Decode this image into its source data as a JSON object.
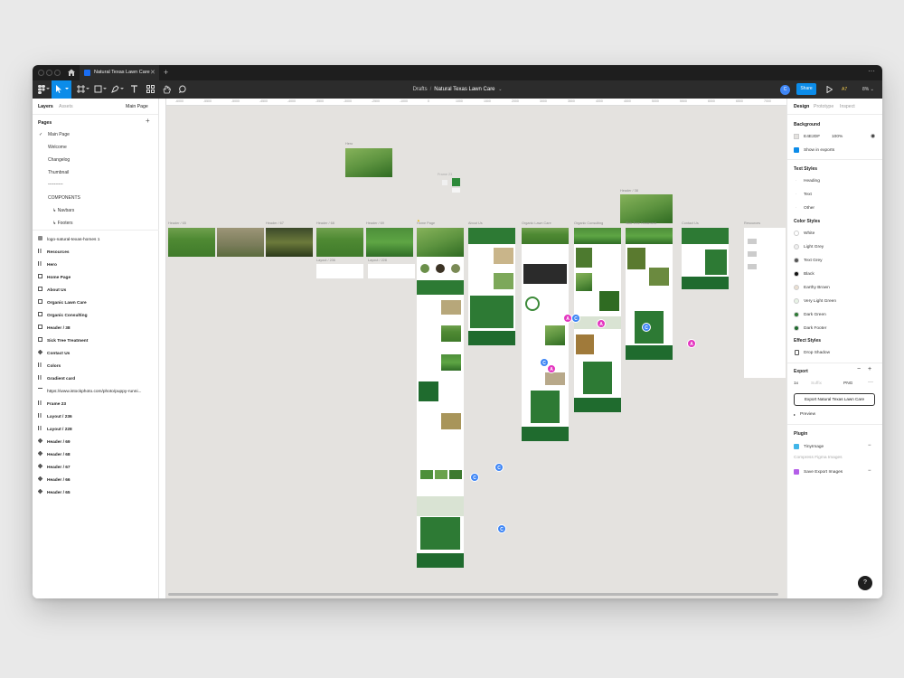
{
  "titlebar": {
    "tab_title": "Natural Texas Lawn Care"
  },
  "toolbar": {
    "breadcrumb_drafts": "Drafts",
    "file_name": "Natural Texas Lawn Care",
    "share_label": "Share",
    "avatar_initial": "C",
    "audio_label": "A7",
    "zoom_label": "8%"
  },
  "left_panel": {
    "tabs": [
      "Layers",
      "Assets"
    ],
    "current_page": "Main Page",
    "pages_heading": "Pages",
    "pages": [
      "Main Page",
      "Welcome",
      "Changelog",
      "Thumbnail",
      "----------",
      "COMPONENTS"
    ],
    "sub_pages": [
      "Navbars",
      "Footers"
    ],
    "layers": [
      "logo-natural-texas-homes 1",
      "Resources",
      "Hero",
      "Home Page",
      "About Us",
      "Organic Lawn Care",
      "Organic Consulting",
      "Header / 38",
      "Sick Tree Treatment",
      "Contact Us",
      "Colors",
      "Gradient card",
      "https://www.istockphoto.com/photo/puppy-runni...",
      "Frame 23",
      "Layout / 236",
      "Layout / 228",
      "Header / 69",
      "Header / 68",
      "Header / 67",
      "Header / 66",
      "Header / 65"
    ]
  },
  "canvas": {
    "ruler_ticks": [
      "-6000",
      "-5500",
      "-5000",
      "-4500",
      "-4000",
      "-3500",
      "-3000",
      "-2500",
      "-1000",
      "0",
      "1000",
      "1500",
      "2000",
      "3000",
      "3500",
      "4000",
      "4500",
      "5000",
      "5500",
      "6000",
      "6500",
      "7000"
    ],
    "frame_labels": {
      "hero": "Hero",
      "frame23": "Frame 23",
      "header65": "Header / 65",
      "header66": "Header / 66",
      "header67": "Header / 67",
      "header68": "Header / 68",
      "header69": "Header / 69",
      "layout236": "Layout / 236",
      "layout228": "Layout / 228",
      "home": "Home Page",
      "about": "About Us",
      "organic_lawn": "Organic Lawn Care",
      "organic_consult": "Organic Consulting",
      "sick_tree": "Sick Tree Treatment",
      "contact": "Contact Us",
      "resources": "Resources",
      "header38": "Header / 38"
    },
    "badges": {
      "blue": "C",
      "pink": "A"
    }
  },
  "right_panel": {
    "tabs": [
      "Design",
      "Prototype",
      "Inspect"
    ],
    "background_title": "Background",
    "bg_hex": "E4E2DF",
    "bg_opacity": "100%",
    "show_in_exports": "Show in exports",
    "text_styles_title": "Text Styles",
    "text_styles": [
      "Heading",
      "Text",
      "Other"
    ],
    "color_styles_title": "Color Styles",
    "color_styles": [
      {
        "name": "White",
        "color": "#ffffff"
      },
      {
        "name": "Light Grey",
        "color": "#efefef"
      },
      {
        "name": "Text Grey",
        "color": "#555555"
      },
      {
        "name": "Black",
        "color": "#111111"
      },
      {
        "name": "Earthy Brown",
        "color": "#eadfd2"
      },
      {
        "name": "Very Light Green",
        "color": "#e8f3e6"
      },
      {
        "name": "Dark Green",
        "color": "#2d7a34"
      },
      {
        "name": "Dark Footer",
        "color": "#1f6b2e"
      }
    ],
    "effect_styles_title": "Effect Styles",
    "effect_styles": [
      "Drop Shadow"
    ],
    "export_title": "Export",
    "export_scale": "1x",
    "export_suffix": "Suffix",
    "export_format": "PNG",
    "export_button": "Export Natural Texas Lawn Care",
    "preview_label": "Preview",
    "plugin_title": "Plugin",
    "plugins": [
      "TinyImage",
      "Save Export Images"
    ],
    "plugin_desc": "Compress Figma Images",
    "help": "?"
  }
}
